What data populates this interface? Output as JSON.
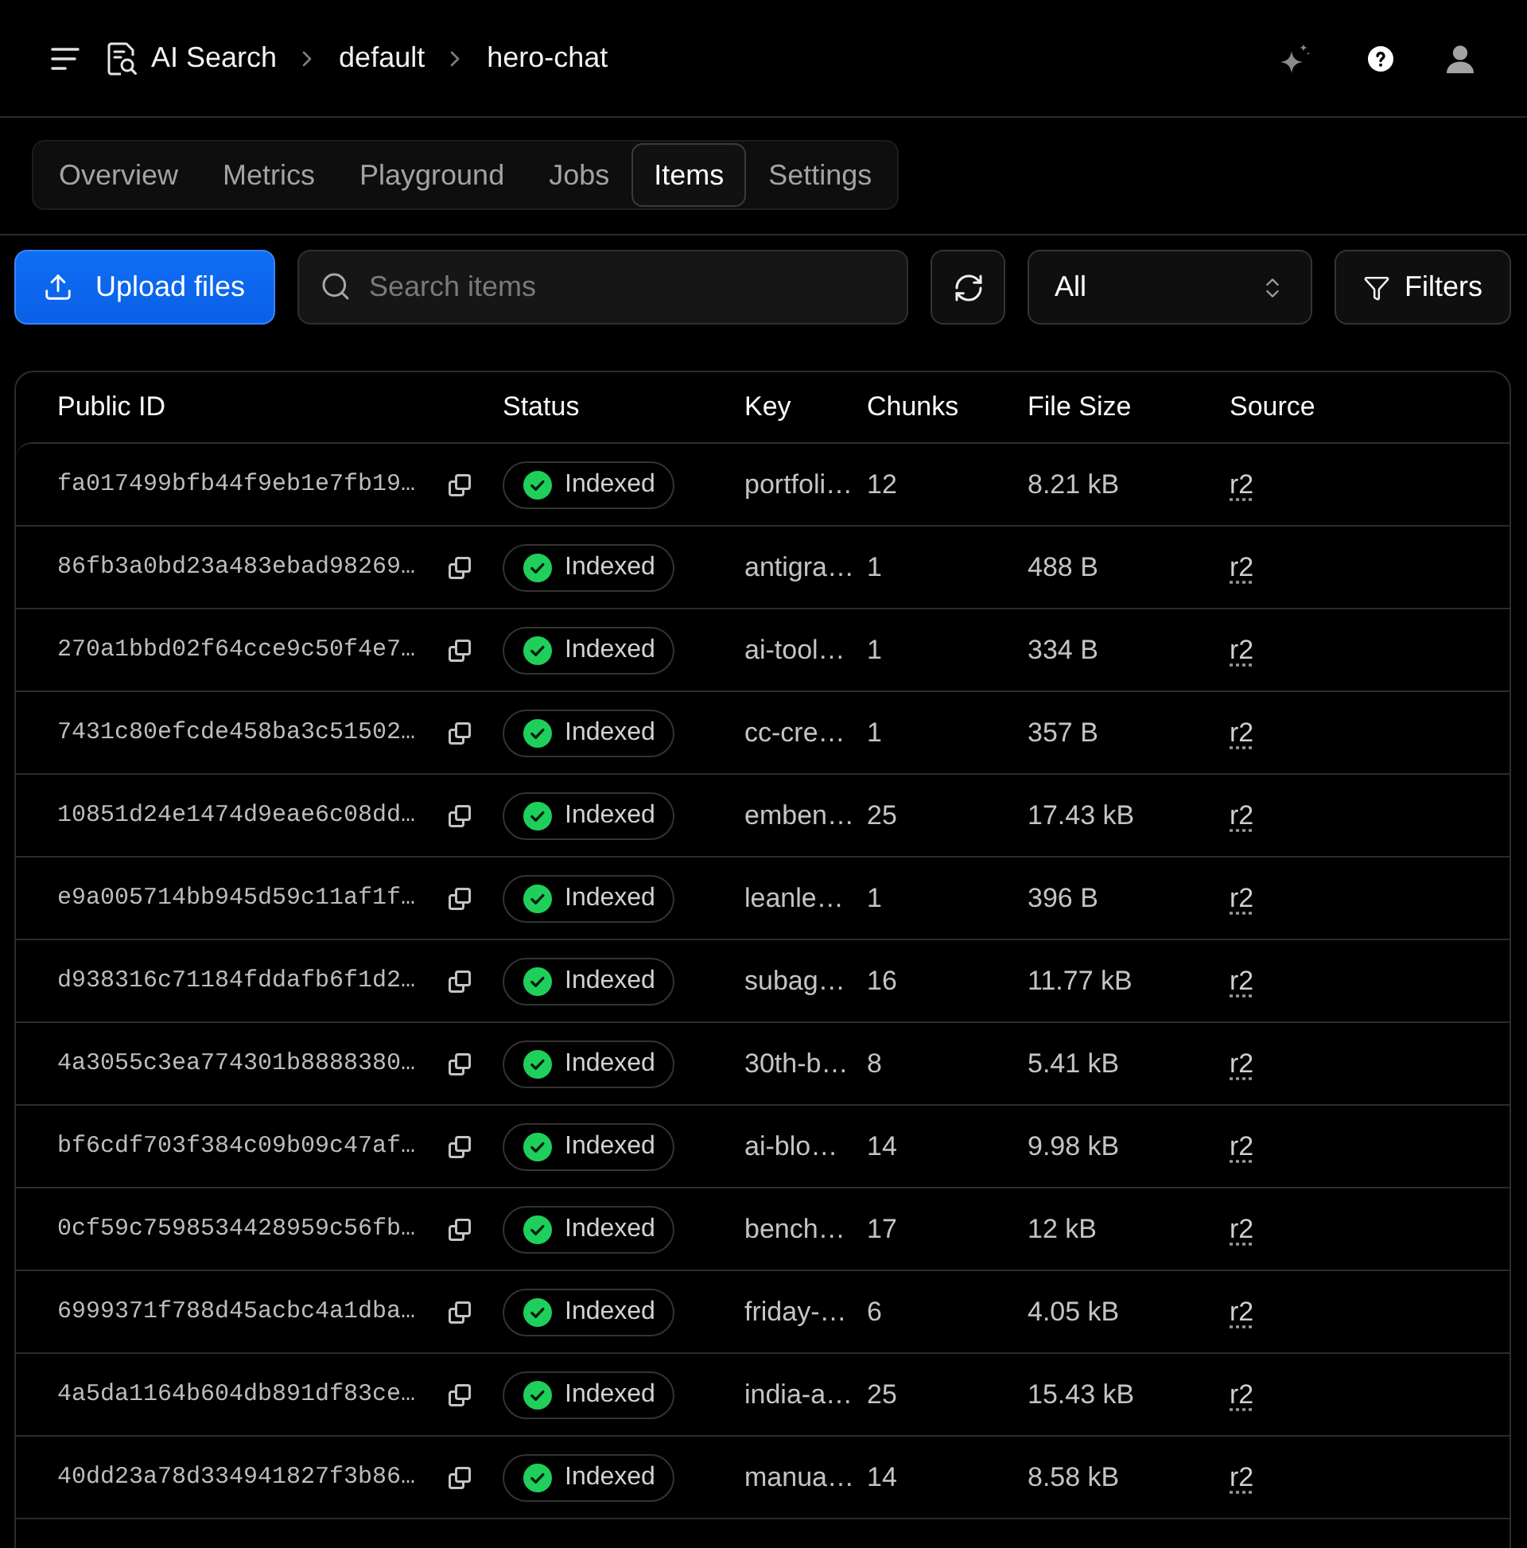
{
  "header": {
    "breadcrumbs": [
      {
        "label": "AI Search",
        "kind": "service"
      },
      {
        "label": "default",
        "kind": "page"
      },
      {
        "label": "hero-chat",
        "kind": "page"
      }
    ]
  },
  "tabs": [
    {
      "label": "Overview",
      "selected": false
    },
    {
      "label": "Metrics",
      "selected": false
    },
    {
      "label": "Playground",
      "selected": false
    },
    {
      "label": "Jobs",
      "selected": false
    },
    {
      "label": "Items",
      "selected": true
    },
    {
      "label": "Settings",
      "selected": false
    }
  ],
  "toolbar": {
    "upload_button": "Upload files",
    "search": {
      "placeholder": "Search items"
    },
    "filter_select": {
      "value": "All"
    },
    "filters_button": "Filters"
  },
  "table": {
    "columns": [
      "Public ID",
      "Status",
      "Key",
      "Chunks",
      "File Size",
      "Source"
    ],
    "rows": [
      {
        "public_id": "fa017499bfb44f9eb1e7fb19…",
        "status": {
          "label": "Indexed",
          "kind": "indexed"
        },
        "key": "portfoli…",
        "chunks": "12",
        "file_size": "8.21 kB",
        "source": "r2"
      },
      {
        "public_id": "86fb3a0bd23a483ebad98269…",
        "status": {
          "label": "Indexed",
          "kind": "indexed"
        },
        "key": "antigra…",
        "chunks": "1",
        "file_size": "488 B",
        "source": "r2"
      },
      {
        "public_id": "270a1bbd02f64cce9c50f4e7…",
        "status": {
          "label": "Indexed",
          "kind": "indexed"
        },
        "key": "ai-tool…",
        "chunks": "1",
        "file_size": "334 B",
        "source": "r2"
      },
      {
        "public_id": "7431c80efcde458ba3c51502…",
        "status": {
          "label": "Indexed",
          "kind": "indexed"
        },
        "key": "cc-cre…",
        "chunks": "1",
        "file_size": "357 B",
        "source": "r2"
      },
      {
        "public_id": "10851d24e1474d9eae6c08dd…",
        "status": {
          "label": "Indexed",
          "kind": "indexed"
        },
        "key": "emben…",
        "chunks": "25",
        "file_size": "17.43 kB",
        "source": "r2"
      },
      {
        "public_id": "e9a005714bb945d59c11af1f…",
        "status": {
          "label": "Indexed",
          "kind": "indexed"
        },
        "key": "leanle…",
        "chunks": "1",
        "file_size": "396 B",
        "source": "r2"
      },
      {
        "public_id": "d938316c71184fddafb6f1d2…",
        "status": {
          "label": "Indexed",
          "kind": "indexed"
        },
        "key": "subag…",
        "chunks": "16",
        "file_size": "11.77 kB",
        "source": "r2"
      },
      {
        "public_id": "4a3055c3ea774301b8888380…",
        "status": {
          "label": "Indexed",
          "kind": "indexed"
        },
        "key": "30th-b…",
        "chunks": "8",
        "file_size": "5.41 kB",
        "source": "r2"
      },
      {
        "public_id": "bf6cdf703f384c09b09c47af…",
        "status": {
          "label": "Indexed",
          "kind": "indexed"
        },
        "key": "ai-blo…",
        "chunks": "14",
        "file_size": "9.98 kB",
        "source": "r2"
      },
      {
        "public_id": "0cf59c7598534428959c56fb…",
        "status": {
          "label": "Indexed",
          "kind": "indexed"
        },
        "key": "bench…",
        "chunks": "17",
        "file_size": "12 kB",
        "source": "r2"
      },
      {
        "public_id": "6999371f788d45acbc4a1dba…",
        "status": {
          "label": "Indexed",
          "kind": "indexed"
        },
        "key": "friday-…",
        "chunks": "6",
        "file_size": "4.05 kB",
        "source": "r2"
      },
      {
        "public_id": "4a5da1164b604db891df83ce…",
        "status": {
          "label": "Indexed",
          "kind": "indexed"
        },
        "key": "india-a…",
        "chunks": "25",
        "file_size": "15.43 kB",
        "source": "r2"
      },
      {
        "public_id": "40dd23a78d334941827f3b86…",
        "status": {
          "label": "Indexed",
          "kind": "indexed"
        },
        "key": "manua…",
        "chunks": "14",
        "file_size": "8.58 kB",
        "source": "r2"
      }
    ]
  }
}
